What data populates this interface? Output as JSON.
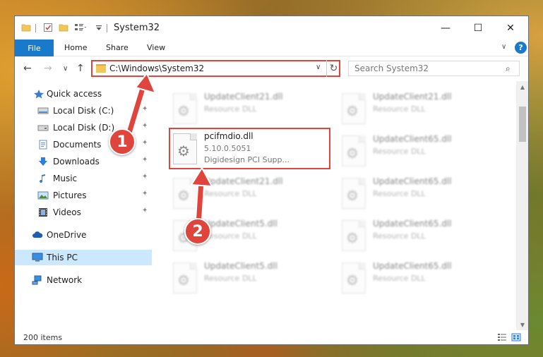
{
  "window": {
    "title": "System32",
    "minimize_glyph": "—",
    "maximize_glyph": "☐",
    "close_glyph": "✕"
  },
  "ribbon": {
    "file": "File",
    "home": "Home",
    "share": "Share",
    "view": "View",
    "expand_glyph": "∨",
    "help_glyph": "?"
  },
  "nav": {
    "back_glyph": "←",
    "forward_glyph": "→",
    "recent_glyph": "∨",
    "up_glyph": "↑",
    "address": "C:\\Windows\\System32",
    "address_dropdown_glyph": "∨",
    "refresh_glyph": "↻",
    "search_placeholder": "Search System32",
    "search_glyph": "⌕"
  },
  "sidebar": {
    "quick_access": "Quick access",
    "items": [
      {
        "label": "Local Disk (C:)",
        "pinned": true
      },
      {
        "label": "Local Disk (D:)",
        "pinned": true
      },
      {
        "label": "Documents",
        "pinned": true
      },
      {
        "label": "Downloads",
        "pinned": true
      },
      {
        "label": "Music",
        "pinned": true
      },
      {
        "label": "Pictures",
        "pinned": true
      },
      {
        "label": "Videos",
        "pinned": true
      }
    ],
    "onedrive": "OneDrive",
    "this_pc": "This PC",
    "network": "Network",
    "pin_glyph": "📌"
  },
  "files": {
    "left": [
      {
        "name": "UpdateClient21.dll",
        "type": "Resource DLL"
      },
      {
        "name": "pcifmdio.dll",
        "version": "5.10.0.5051",
        "description": "Digidesign PCI Supp..."
      },
      {
        "name": "UpdateClient21.dll",
        "type": "Resource DLL"
      },
      {
        "name": "UpdateClient5.dll",
        "type": "Resource DLL"
      },
      {
        "name": "UpdateClient5.dll",
        "type": "Resource DLL"
      }
    ],
    "right": [
      {
        "name": "UpdateClient21.dll",
        "type": "Resource DLL"
      },
      {
        "name": "UpdateClient65.dll",
        "type": "Resource DLL"
      },
      {
        "name": "UpdateClient65.dll",
        "type": "Resource DLL"
      },
      {
        "name": "UpdateClient65.dll",
        "type": "Resource DLL"
      },
      {
        "name": "UpdateClient65.dll",
        "type": "Resource DLL"
      }
    ],
    "gear_glyph": "⚙"
  },
  "scrollbar": {
    "up_glyph": "▲",
    "down_glyph": "▼"
  },
  "status": {
    "item_count": "200 items"
  },
  "annotations": {
    "step1": "1",
    "step2": "2",
    "color": "#e0453d"
  }
}
